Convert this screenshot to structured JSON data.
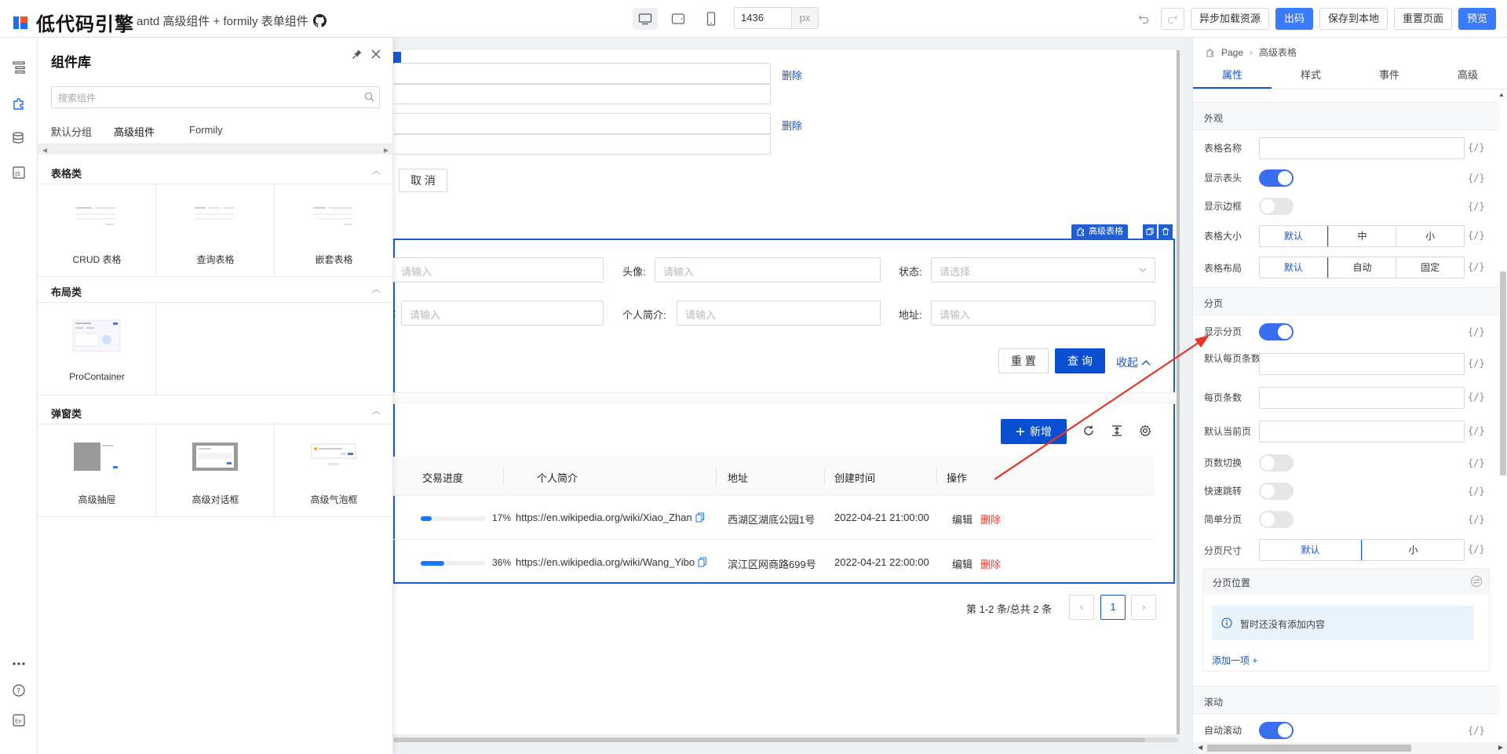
{
  "app": {
    "logo_text": "低代码引擎",
    "subtitle": "antd 高级组件 + formily 表单组件",
    "width_value": "1436",
    "width_unit": "px"
  },
  "toolbar": {
    "async_load": "异步加载资源",
    "code": "出码",
    "save_local": "保存到本地",
    "reset_page": "重置页面",
    "preview": "预览"
  },
  "library": {
    "title": "组件库",
    "search_placeholder": "搜索组件",
    "tabs": [
      "默认分组",
      "高级组件",
      "Formily"
    ],
    "categories": [
      {
        "name": "表格类",
        "items": [
          "CRUD 表格",
          "查询表格",
          "嵌套表格"
        ]
      },
      {
        "name": "布局类",
        "items": [
          "ProContainer"
        ]
      },
      {
        "name": "弹窗类",
        "items": [
          "高级抽屉",
          "高级对话框",
          "高级气泡框"
        ]
      }
    ]
  },
  "canvas": {
    "delete_1": "删除",
    "delete_2": "删除",
    "cancel_btn": "取 消",
    "component_tag": "高级表格",
    "search_form": {
      "field1_placeholder": "请输入",
      "avatar_label": "头像:",
      "avatar_placeholder": "请输入",
      "status_label": "状态:",
      "status_placeholder": "请选择",
      "field4_colon": ":",
      "field4_placeholder": "请输入",
      "bio_label": "个人简介:",
      "bio_placeholder": "请输入",
      "addr_label": "地址:",
      "addr_placeholder": "请输入",
      "reset": "重 置",
      "query": "查 询",
      "collapse": "收起"
    },
    "table": {
      "add_btn": "新增",
      "headers": [
        "交易进度",
        "个人简介",
        "地址",
        "创建时间",
        "操作"
      ],
      "rows": [
        {
          "progress": 17,
          "progress_text": "17%",
          "bio": "https://en.wikipedia.org/wiki/Xiao_Zhan",
          "address": "西湖区湖底公园1号",
          "created": "2022-04-21 21:00:00",
          "edit": "编辑",
          "delete": "删除"
        },
        {
          "progress": 36,
          "progress_text": "36%",
          "bio": "https://en.wikipedia.org/wiki/Wang_Yibo",
          "address": "滨江区网商路699号",
          "created": "2022-04-21 22:00:00",
          "edit": "编辑",
          "delete": "删除"
        }
      ],
      "total_text": "第 1-2 条/总共 2 条",
      "current_page": "1"
    }
  },
  "settings": {
    "breadcrumb_root": "Page",
    "breadcrumb_current": "高级表格",
    "tabs": [
      "属性",
      "样式",
      "事件",
      "高级"
    ],
    "fx": "{/}",
    "appearance": {
      "title": "外观",
      "table_name": "表格名称",
      "show_header": "显示表头",
      "show_border": "显示边框",
      "table_size": "表格大小",
      "size_options": [
        "默认",
        "中",
        "小"
      ],
      "table_layout": "表格布局",
      "layout_options": [
        "默认",
        "自动",
        "固定"
      ]
    },
    "pagination": {
      "title": "分页",
      "show_pagination": "显示分页",
      "default_page_size": "默认每页条数",
      "page_size": "每页条数",
      "default_current": "默认当前页",
      "page_size_switch": "页数切换",
      "quick_jump": "快速跳转",
      "simple": "简单分页",
      "pager_size": "分页尺寸",
      "pager_size_options": [
        "默认",
        "小"
      ],
      "position_title": "分页位置",
      "empty_text": "暂时还没有添加内容",
      "add_item": "添加一项 +"
    },
    "scroll": {
      "title": "滚动",
      "auto_scroll": "自动滚动"
    }
  },
  "colors": {
    "primary": "#1456d6",
    "accent": "#3a7bfd",
    "danger": "#e8423d",
    "annotation_arrow": "#e8352c"
  }
}
